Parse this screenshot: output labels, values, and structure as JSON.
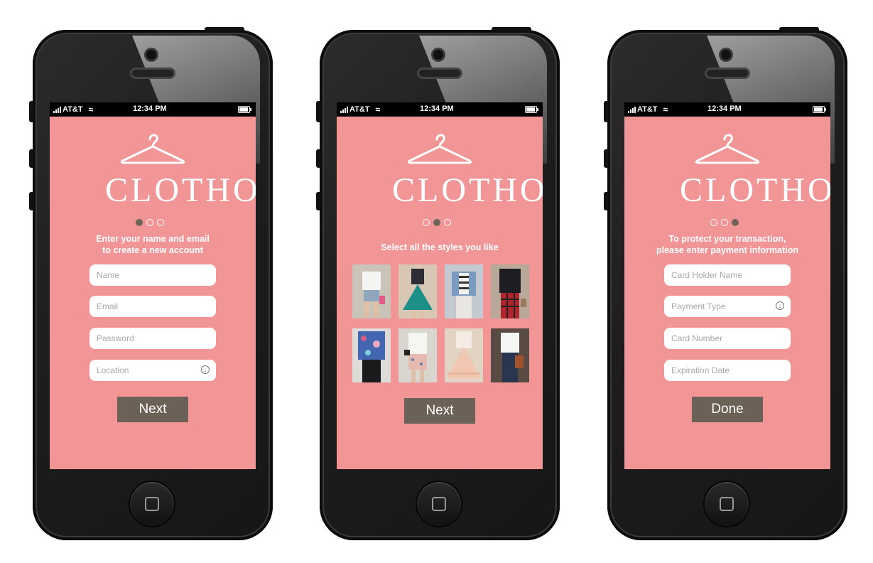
{
  "status_bar": {
    "carrier": "AT&T",
    "time": "12:34 PM"
  },
  "brand": {
    "name": "CLOTHO"
  },
  "colors": {
    "screen_bg": "#f29597",
    "button_bg": "#6b6156",
    "dot_active": "#6e6458"
  },
  "screens": [
    {
      "step": 1,
      "instruction_line1": "Enter your name and email",
      "instruction_line2": "to create a new account",
      "fields": [
        {
          "placeholder": "Name"
        },
        {
          "placeholder": "Email"
        },
        {
          "placeholder": "Password"
        },
        {
          "placeholder": "Location",
          "icon": "chevron-down-circle-icon"
        }
      ],
      "button_label": "Next"
    },
    {
      "step": 2,
      "instruction_line1": "Select all the styles you like",
      "styles": [
        {
          "icon": "outfit-white-tee-denim-shorts"
        },
        {
          "icon": "outfit-teal-skirt"
        },
        {
          "icon": "outfit-striped-top-denim-jacket"
        },
        {
          "icon": "outfit-black-top-plaid-pants"
        },
        {
          "icon": "outfit-floral-jacket"
        },
        {
          "icon": "outfit-white-top-print-skirt"
        },
        {
          "icon": "outfit-peach-skirt"
        },
        {
          "icon": "outfit-white-blouse-jeans"
        }
      ],
      "button_label": "Next"
    },
    {
      "step": 3,
      "instruction_line1": "To protect your transaction,",
      "instruction_line2": "please enter payment information",
      "fields": [
        {
          "placeholder": "Card Holder Name"
        },
        {
          "placeholder": "Payment Type",
          "icon": "chevron-down-circle-icon"
        },
        {
          "placeholder": "Card Number"
        },
        {
          "placeholder": "Expiration Date"
        }
      ],
      "button_label": "Done"
    }
  ]
}
